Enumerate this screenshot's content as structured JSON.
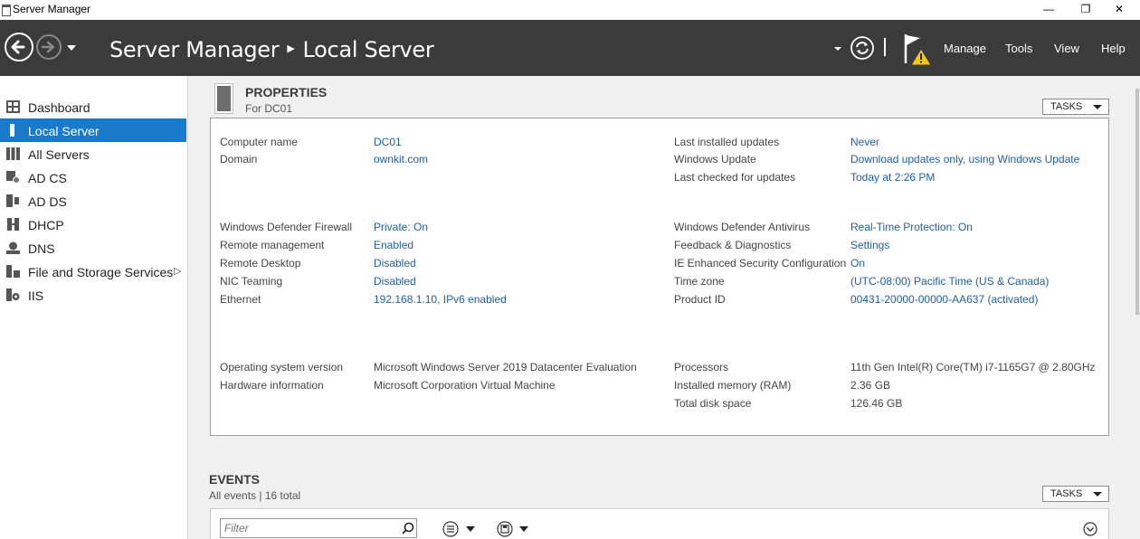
{
  "window": {
    "title": "Server Manager",
    "minimize": "—",
    "maximize": "❐",
    "close": "✕"
  },
  "header": {
    "breadcrumb_root": "Server Manager",
    "breadcrumb_sep": "▶",
    "breadcrumb_current": "Local Server",
    "menu": [
      "Manage",
      "Tools",
      "View",
      "Help"
    ]
  },
  "sidebar": {
    "items": [
      {
        "label": "Dashboard",
        "icon": "dashboard-icon"
      },
      {
        "label": "Local Server",
        "icon": "local-server-icon",
        "active": true
      },
      {
        "label": "All Servers",
        "icon": "all-servers-icon"
      },
      {
        "label": "AD CS",
        "icon": "ad-cs-icon"
      },
      {
        "label": "AD DS",
        "icon": "ad-ds-icon"
      },
      {
        "label": "DHCP",
        "icon": "dhcp-icon"
      },
      {
        "label": "DNS",
        "icon": "dns-icon"
      },
      {
        "label": "File and Storage Services",
        "icon": "storage-icon",
        "expander": "▷"
      },
      {
        "label": "IIS",
        "icon": "iis-icon"
      }
    ]
  },
  "properties": {
    "title": "PROPERTIES",
    "subtitle": "For DC01",
    "tasks_label": "TASKS",
    "left_col": [
      {
        "label": "Computer name",
        "value": "DC01",
        "link": true
      },
      {
        "label": "Domain",
        "value": "ownkit.com",
        "link": true
      },
      {
        "label": "Windows Defender Firewall",
        "value": "Private: On",
        "link": true
      },
      {
        "label": "Remote management",
        "value": "Enabled",
        "link": true
      },
      {
        "label": "Remote Desktop",
        "value": "Disabled",
        "link": true
      },
      {
        "label": "NIC Teaming",
        "value": "Disabled",
        "link": true
      },
      {
        "label": "Ethernet",
        "value": "192.168.1.10, IPv6 enabled",
        "link": true
      },
      {
        "label": "Operating system version",
        "value": "Microsoft Windows Server 2019 Datacenter Evaluation",
        "link": false
      },
      {
        "label": "Hardware information",
        "value": "Microsoft Corporation Virtual Machine",
        "link": false
      }
    ],
    "right_col": [
      {
        "label": "Last installed updates",
        "value": "Never",
        "link": true
      },
      {
        "label": "Windows Update",
        "value": "Download updates only, using Windows Update",
        "link": true
      },
      {
        "label": "Last checked for updates",
        "value": "Today at 2:26 PM",
        "link": true
      },
      {
        "label": "Windows Defender Antivirus",
        "value": "Real-Time Protection: On",
        "link": true
      },
      {
        "label": "Feedback & Diagnostics",
        "value": "Settings",
        "link": true
      },
      {
        "label": "IE Enhanced Security Configuration",
        "value": "On",
        "link": true
      },
      {
        "label": "Time zone",
        "value": "(UTC-08:00) Pacific Time (US & Canada)",
        "link": true
      },
      {
        "label": "Product ID",
        "value": "00431-20000-00000-AA637 (activated)",
        "link": true
      },
      {
        "label": "Processors",
        "value": "11th Gen Intel(R) Core(TM) i7-1165G7 @ 2.80GHz",
        "link": false
      },
      {
        "label": "Installed memory (RAM)",
        "value": "2.36 GB",
        "link": false
      },
      {
        "label": "Total disk space",
        "value": "126.46 GB",
        "link": false
      }
    ]
  },
  "events": {
    "title": "EVENTS",
    "summary": "All events | 16 total",
    "tasks_label": "TASKS",
    "filter_placeholder": "Filter"
  },
  "colors": {
    "header_bg": "#3b3b3b",
    "accent": "#1979ca",
    "link": "#1f5fa6",
    "warning": "#f2c811"
  }
}
